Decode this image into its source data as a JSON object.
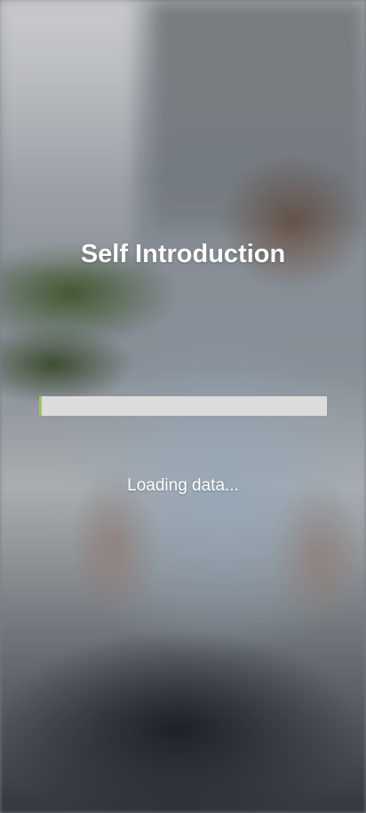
{
  "screen": {
    "title": "Self Introduction",
    "background_image": "blurred-photo-person-smiling"
  },
  "loader": {
    "progress": 0.01,
    "status_text": "Loading data...",
    "track_color": "#dcdcdc",
    "fill_color": "#9cc84a"
  }
}
